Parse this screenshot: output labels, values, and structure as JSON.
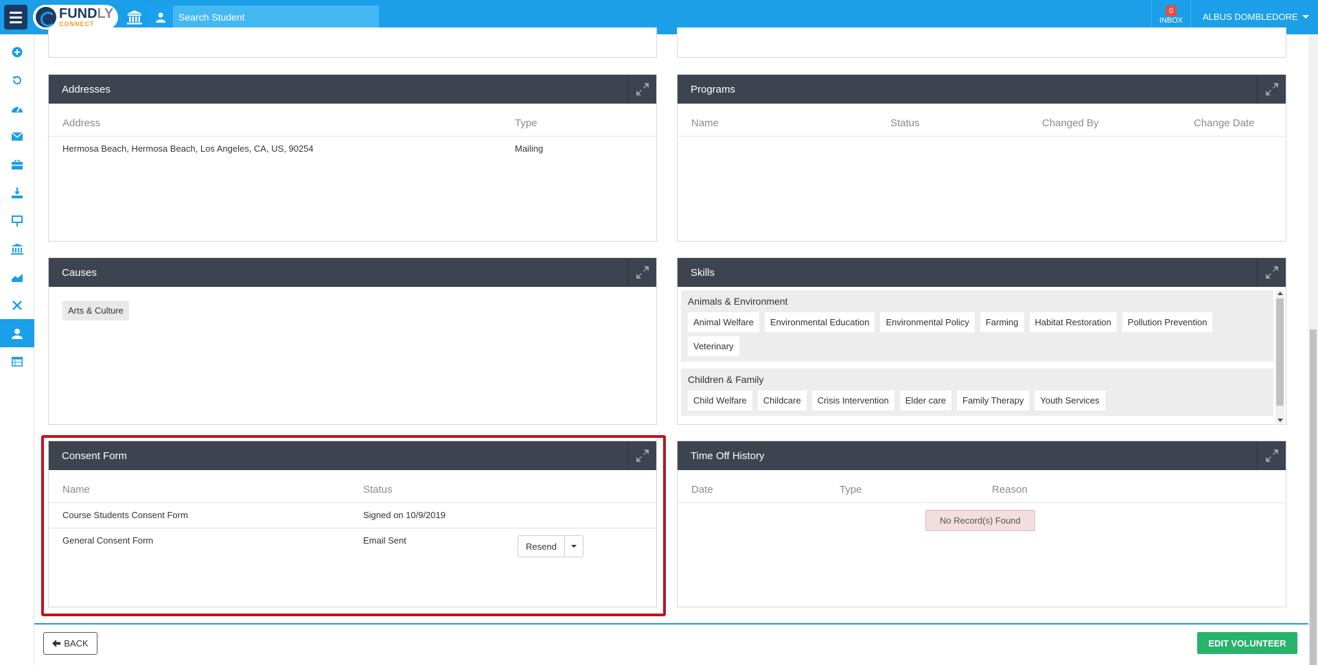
{
  "topbar": {
    "search_placeholder": "Search Student",
    "inbox_count": "0",
    "inbox_label": "INBOX",
    "user_name": "ALBUS DOMBLEDORE",
    "logo_main": "FUND",
    "logo_main_suffix": "LY",
    "logo_sub": "CONNECT"
  },
  "sidebar": {
    "items": [
      "plus-circle-icon",
      "history-icon",
      "dashboard-icon",
      "envelope-icon",
      "briefcase-icon",
      "download-icon",
      "presentation-icon",
      "institution-icon",
      "chart-icon",
      "tools-icon",
      "user-icon",
      "table-icon"
    ],
    "active_index": 10
  },
  "addresses": {
    "title": "Addresses",
    "columns": [
      "Address",
      "Type"
    ],
    "rows": [
      {
        "address": "Hermosa Beach, Hermosa Beach, Los Angeles, CA, US, 90254",
        "type": "Mailing"
      }
    ]
  },
  "programs": {
    "title": "Programs",
    "columns": [
      "Name",
      "Status",
      "Changed By",
      "Change Date"
    ]
  },
  "causes": {
    "title": "Causes",
    "tags": [
      "Arts & Culture"
    ]
  },
  "skills": {
    "title": "Skills",
    "groups": [
      {
        "name": "Animals & Environment",
        "items": [
          "Animal Welfare",
          "Environmental Education",
          "Environmental Policy",
          "Farming",
          "Habitat Restoration",
          "Pollution Prevention",
          "Veterinary"
        ]
      },
      {
        "name": "Children & Family",
        "items": [
          "Child Welfare",
          "Childcare",
          "Crisis Intervention",
          "Elder care",
          "Family Therapy",
          "Youth Services"
        ]
      }
    ]
  },
  "consent": {
    "title": "Consent Form",
    "columns": [
      "Name",
      "Status"
    ],
    "rows": [
      {
        "name": "Course Students Consent Form",
        "status": "Signed on 10/9/2019"
      },
      {
        "name": "General Consent Form",
        "status": "Email Sent",
        "action": "Resend"
      }
    ]
  },
  "timeoff": {
    "title": "Time Off History",
    "columns": [
      "Date",
      "Type",
      "Reason"
    ],
    "empty_text": "No Record(s) Found"
  },
  "footer": {
    "back_label": "BACK",
    "edit_label": "EDIT VOLUNTEER"
  },
  "colors": {
    "topbar": "#1a9fe8",
    "panel_header": "#3d4450",
    "edit_button": "#27b36b",
    "highlight": "#c1121f"
  }
}
